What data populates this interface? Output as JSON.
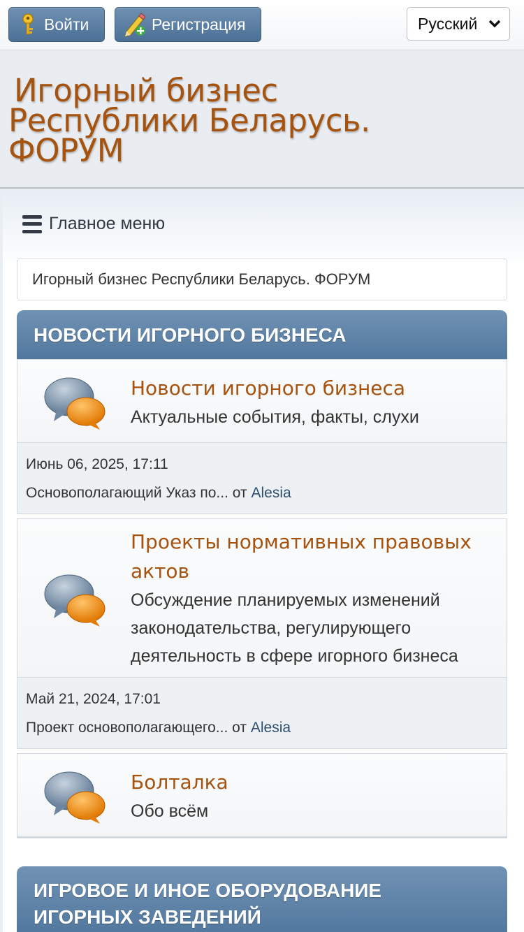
{
  "topbar": {
    "login_label": "Войти",
    "register_label": "Регистрация",
    "language_selected": "Русский"
  },
  "header": {
    "forum_title_line1": "Игорный бизнес",
    "forum_title_line2": "Республики Беларусь.",
    "forum_title_line3": "ФОРУМ"
  },
  "nav": {
    "main_menu_label": "Главное меню",
    "breadcrumb": "Игорный бизнес Республики Беларусь. ФОРУМ"
  },
  "categories": [
    {
      "title": "НОВОСТИ ИГОРНОГО БИЗНЕСА",
      "boards": [
        {
          "title": "Новости игорного бизнеса",
          "description": "Актуальные события, факты, слухи",
          "last_post_date": "Июнь 06, 2025, 17:11",
          "last_post_subject": "Основополагающий Указ по...",
          "last_post_by": "от",
          "last_post_author": "Alesia"
        },
        {
          "title_line1": "Проекты нормативных правовых",
          "title_line2": "актов",
          "description_line1": "Обсуждение планируемых изменений",
          "description_line2": "законодательства, регулирующего",
          "description_line3": "деятельность в сфере игорного бизнеса",
          "last_post_date": "Май 21, 2024, 17:01",
          "last_post_subject": "Проект основополагающего...",
          "last_post_by": "от",
          "last_post_author": "Alesia"
        },
        {
          "title": "Болталка",
          "description": "Обо всём"
        }
      ]
    },
    {
      "title_line1": "ИГРОВОЕ И ИНОЕ ОБОРУДОВАНИЕ",
      "title_line2": "ИГОРНЫХ ЗАВЕДЕНИЙ"
    }
  ],
  "colors": {
    "category_header": "#5f83a8",
    "board_title": "#a5530f",
    "forum_title": "#a5530f",
    "button_bg": "#5c7fa4"
  },
  "icons": {
    "login": "key-icon",
    "register": "pencil-plus-icon",
    "language": "chevron-down-icon",
    "menu": "hamburger-icon",
    "board": "speech-bubbles-icon"
  }
}
